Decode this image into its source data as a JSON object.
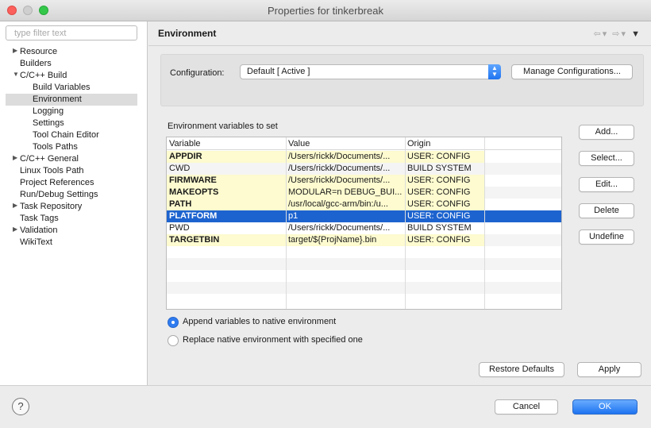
{
  "window": {
    "title": "Properties for tinkerbreak"
  },
  "sidebar": {
    "filter_placeholder": "type filter text",
    "items": [
      {
        "label": "Resource",
        "twisty": "▶"
      },
      {
        "label": "Builders",
        "twisty": ""
      },
      {
        "label": "C/C++ Build",
        "twisty": "▼"
      },
      {
        "label": "Build Variables",
        "twisty": ""
      },
      {
        "label": "Environment",
        "twisty": ""
      },
      {
        "label": "Logging",
        "twisty": ""
      },
      {
        "label": "Settings",
        "twisty": ""
      },
      {
        "label": "Tool Chain Editor",
        "twisty": ""
      },
      {
        "label": "Tools Paths",
        "twisty": ""
      },
      {
        "label": "C/C++ General",
        "twisty": "▶"
      },
      {
        "label": "Linux Tools Path",
        "twisty": ""
      },
      {
        "label": "Project References",
        "twisty": ""
      },
      {
        "label": "Run/Debug Settings",
        "twisty": ""
      },
      {
        "label": "Task Repository",
        "twisty": "▶"
      },
      {
        "label": "Task Tags",
        "twisty": ""
      },
      {
        "label": "Validation",
        "twisty": "▶"
      },
      {
        "label": "WikiText",
        "twisty": ""
      }
    ]
  },
  "page": {
    "title": "Environment",
    "nav": {
      "back": "⇦",
      "forward": "⇨",
      "menu": "▾"
    },
    "configuration": {
      "label": "Configuration:",
      "value": "Default  [ Active ]",
      "manage_label": "Manage Configurations..."
    },
    "vars_label": "Environment variables to set",
    "table": {
      "headers": [
        "Variable",
        "Value",
        "Origin"
      ],
      "rows": [
        {
          "variable": "APPDIR",
          "value": "/Users/rickk/Documents/...",
          "origin": "USER: CONFIG"
        },
        {
          "variable": "CWD",
          "value": "/Users/rickk/Documents/...",
          "origin": "BUILD SYSTEM"
        },
        {
          "variable": "FIRMWARE",
          "value": "/Users/rickk/Documents/...",
          "origin": "USER: CONFIG"
        },
        {
          "variable": "MAKEOPTS",
          "value": "MODULAR=n DEBUG_BUI...",
          "origin": "USER: CONFIG"
        },
        {
          "variable": "PATH",
          "value": "/usr/local/gcc-arm/bin:/u...",
          "origin": "USER: CONFIG"
        },
        {
          "variable": "PLATFORM",
          "value": "p1",
          "origin": "USER: CONFIG"
        },
        {
          "variable": "PWD",
          "value": "/Users/rickk/Documents/...",
          "origin": "BUILD SYSTEM"
        },
        {
          "variable": "TARGETBIN",
          "value": "target/${ProjName}.bin",
          "origin": "USER: CONFIG"
        }
      ]
    },
    "side_buttons": {
      "add": "Add...",
      "select": "Select...",
      "edit": "Edit...",
      "delete": "Delete",
      "undefine": "Undefine"
    },
    "radios": {
      "append": "Append variables to native environment",
      "replace": "Replace native environment with specified one"
    },
    "restore_defaults": "Restore Defaults",
    "apply": "Apply"
  },
  "footer": {
    "help": "?",
    "cancel": "Cancel",
    "ok": "OK"
  },
  "colors": {
    "selection": "#1d63cf",
    "user_cell": "#fdfbcf",
    "primary": "#1e73f0"
  }
}
